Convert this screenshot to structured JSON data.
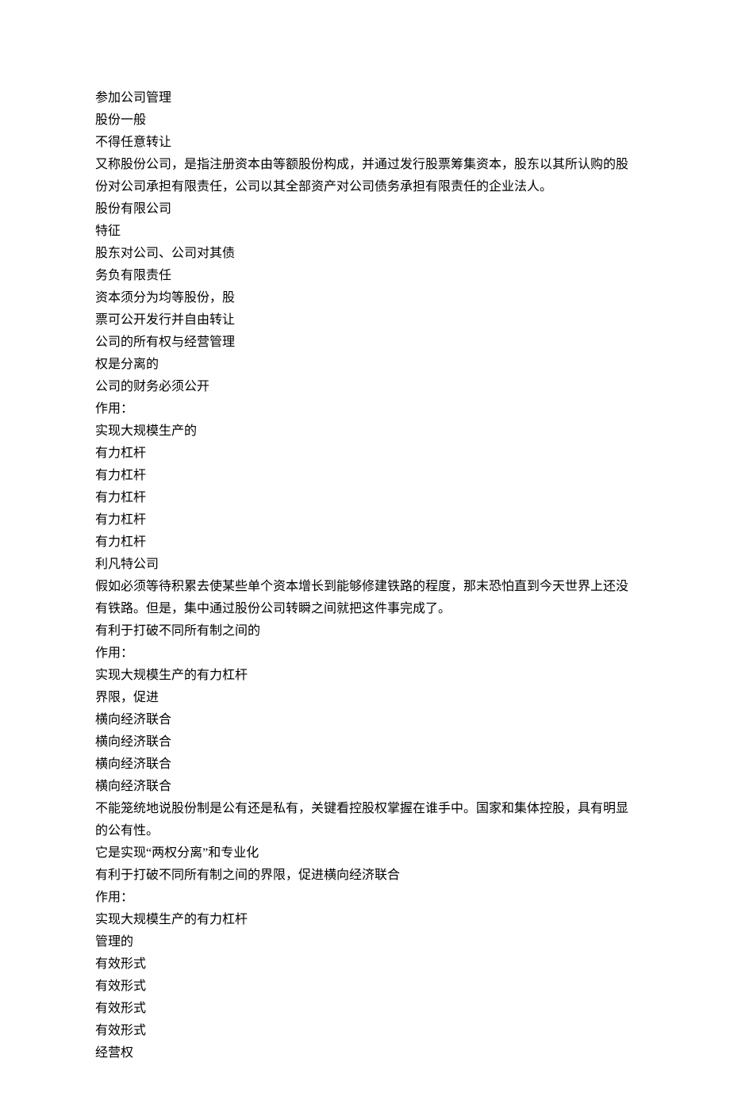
{
  "lines": [
    "参加公司管理",
    "股份一般",
    "不得任意转让",
    "又称股份公司，是指注册资本由等额股份构成，并通过发行股票筹集资本，股东以其所认购的股份对公司承担有限责任，公司以其全部资产对公司债务承担有限责任的企业法人。",
    "股份有限公司",
    "特征",
    "股东对公司、公司对其债",
    "务负有限责任",
    "资本须分为均等股份，股",
    "票可公开发行并自由转让",
    "公司的所有权与经营管理",
    "权是分离的",
    "公司的财务必须公开",
    "作用：",
    "实现大规模生产的",
    "有力杠杆",
    "有力杠杆",
    "有力杠杆",
    "有力杠杆",
    "有力杠杆",
    "利凡特公司",
    "假如必须等待积累去使某些单个资本增长到能够修建铁路的程度，那末恐怕直到今天世界上还没有铁路。但是，集中通过股份公司转瞬之间就把这件事完成了。",
    "有利于打破不同所有制之间的",
    "作用：",
    "实现大规模生产的有力杠杆",
    "界限，促进",
    "横向经济联合",
    "横向经济联合",
    "横向经济联合",
    "横向经济联合",
    "不能笼统地说股份制是公有还是私有，关键看控股权掌握在谁手中。国家和集体控股，具有明显的公有性。",
    "它是实现“两权分离”和专业化",
    "有利于打破不同所有制之间的界限，促进横向经济联合",
    "作用：",
    "实现大规模生产的有力杠杆",
    "管理的",
    "有效形式",
    "有效形式",
    "有效形式",
    "有效形式",
    "经营权"
  ]
}
